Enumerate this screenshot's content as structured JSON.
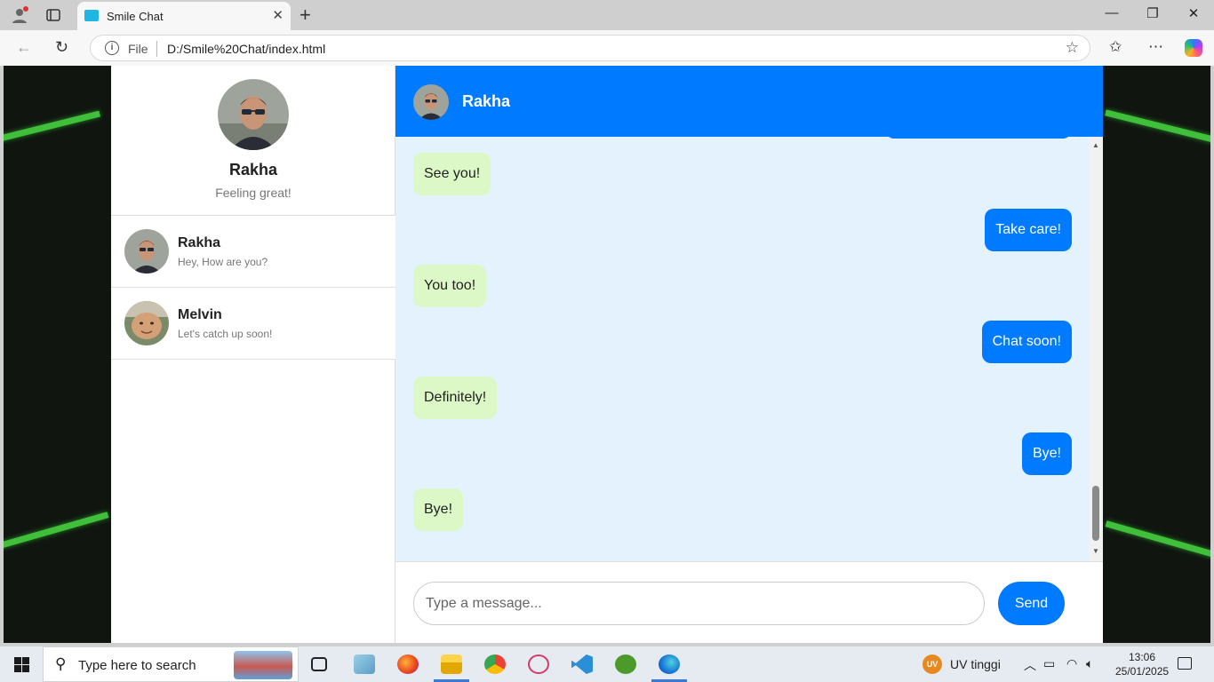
{
  "browser": {
    "tab_title": "Smile Chat",
    "url_scheme_label": "File",
    "url": "D:/Smile%20Chat/index.html"
  },
  "profile": {
    "name": "Rakha",
    "status": "Feeling great!"
  },
  "contacts": [
    {
      "name": "Rakha",
      "last_message": "Hey, How are you?"
    },
    {
      "name": "Melvin",
      "last_message": "Let's catch up soon!"
    }
  ],
  "chat": {
    "header_name": "Rakha",
    "messages": [
      {
        "direction": "in",
        "text": "See you!"
      },
      {
        "direction": "out",
        "text": "Take care!"
      },
      {
        "direction": "in",
        "text": "You too!"
      },
      {
        "direction": "out",
        "text": "Chat soon!"
      },
      {
        "direction": "in",
        "text": "Definitely!"
      },
      {
        "direction": "out",
        "text": "Bye!"
      },
      {
        "direction": "in",
        "text": "Bye!"
      }
    ],
    "input_placeholder": "Type a message...",
    "send_label": "Send"
  },
  "taskbar": {
    "search_placeholder": "Type here to search",
    "weather_badge": "UV",
    "weather_text": "UV tinggi",
    "time": "13:06",
    "date": "25/01/2025"
  },
  "colors": {
    "accent": "#007bff",
    "incoming_bubble": "#dcf8c6",
    "chat_background": "#e3f2fd"
  }
}
